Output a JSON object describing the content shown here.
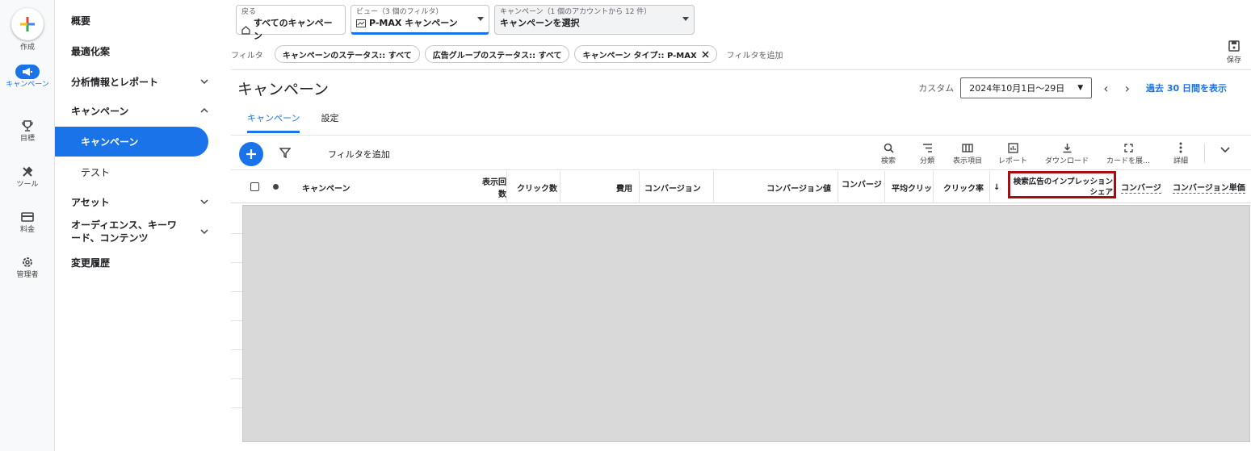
{
  "rail": {
    "create": "作成",
    "campaign": "キャンペーン",
    "goals": "目標",
    "tools": "ツール",
    "billing": "料金",
    "admin": "管理者"
  },
  "nav": {
    "overview": "概要",
    "recommendations": "最適化案",
    "insights": "分析情報とレポート",
    "campaigns_group": "キャンペーン",
    "campaigns": "キャンペーン",
    "experiments": "テスト",
    "assets": "アセット",
    "audiences": "オーディエンス、キーワード、コンテンツ",
    "change_history": "変更履歴"
  },
  "top": {
    "back_label": "戻る",
    "back_value": "すべてのキャンペーン",
    "view_label": "ビュー（3 個のフィルタ）",
    "view_value": "P-MAX キャンペーン",
    "campaign_label": "キャンペーン（1 個のアカウントから 12 件）",
    "campaign_value": "キャンペーンを選択"
  },
  "filters": {
    "label": "フィルタ",
    "chips": [
      "キャンペーンのステータス:: すべて",
      "広告グループのステータス:: すべて",
      "キャンペーン タイプ:: P-MAX"
    ],
    "add": "フィルタを追加"
  },
  "save_label": "保存",
  "page_title": "キャンペーン",
  "date": {
    "label": "カスタム",
    "range": "2024年10月1日～29日",
    "last30": "過去 30 日間を表示"
  },
  "tabs": [
    "キャンペーン",
    "設定"
  ],
  "toolbar": {
    "add_filter": "フィルタを追加",
    "tools": [
      "検索",
      "分類",
      "表示項目",
      "レポート",
      "ダウンロード",
      "カードを展…",
      "詳細"
    ]
  },
  "columns": {
    "campaign": "キャンペーン",
    "impressions": "表示回数",
    "clicks": "クリック数",
    "cost": "費用",
    "conversions": "コンバージョン",
    "conv_value": "コンバージョン値",
    "conv_rate": "コンバージ",
    "avg_cpc": "平均クリッ",
    "ctr": "クリック率",
    "sort_arrow": "↓",
    "search_is": "検索広告のインプレッション シェア",
    "conv2": "コンバージ",
    "cpa": "コンバージョン単価"
  },
  "colors": {
    "accent": "#1a73e8",
    "highlight": "#a50e0e"
  }
}
